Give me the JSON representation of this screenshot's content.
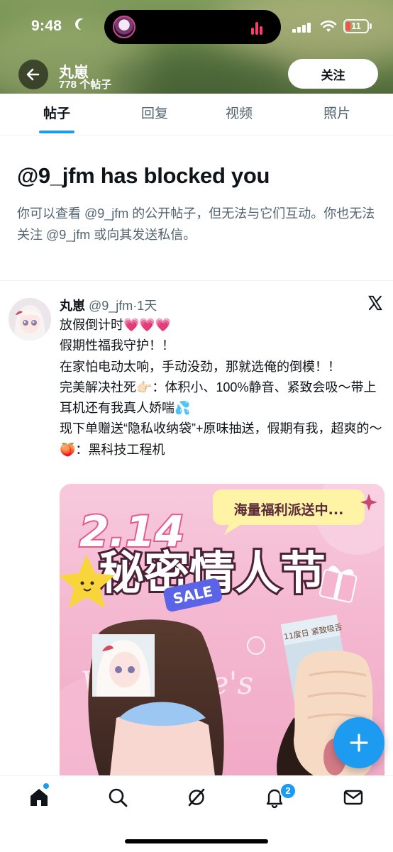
{
  "status_bar": {
    "time": "9:48",
    "battery": "11",
    "icons": [
      "moon-icon",
      "signal-icon",
      "wifi-icon",
      "battery-icon"
    ]
  },
  "header": {
    "name": "丸崽",
    "post_count": "778 个帖子",
    "follow_label": "关注"
  },
  "tabs": [
    {
      "label": "帖子",
      "active": true
    },
    {
      "label": "回复",
      "active": false
    },
    {
      "label": "视频",
      "active": false
    },
    {
      "label": "照片",
      "active": false
    }
  ],
  "blocked": {
    "title": "@9_jfm has blocked you",
    "description": "你可以查看 @9_jfm 的公开帖子，但无法与它们互动。你也无法关注 @9_jfm 或向其发送私信。"
  },
  "post": {
    "author": "丸崽",
    "handle_time": "@9_jfm·1天",
    "text": "放假倒计时💗💗💗\n假期性福我守护！！\n在家怕电动太响，手动没劲，那就选俺的倒模！！\n完美解决社死👉🏻：体积小、100%静音、紧致会吸～带上耳机还有我真人娇喘💦\n现下单赠送“隐私收纳袋”+原味抽送，假期有我，超爽的～\n🍑：黑科技工程机",
    "image": {
      "bubble_text": "海量福利派送中...",
      "date_text": "2.14",
      "headline": "秘密情人节",
      "sale_tag": "SALE",
      "script_text": "Valentine's",
      "box_text": "11度日 紧致吸舌"
    }
  },
  "colors": {
    "accent": "#1d9bf0",
    "text_primary": "#0f1419",
    "text_secondary": "#536471"
  }
}
